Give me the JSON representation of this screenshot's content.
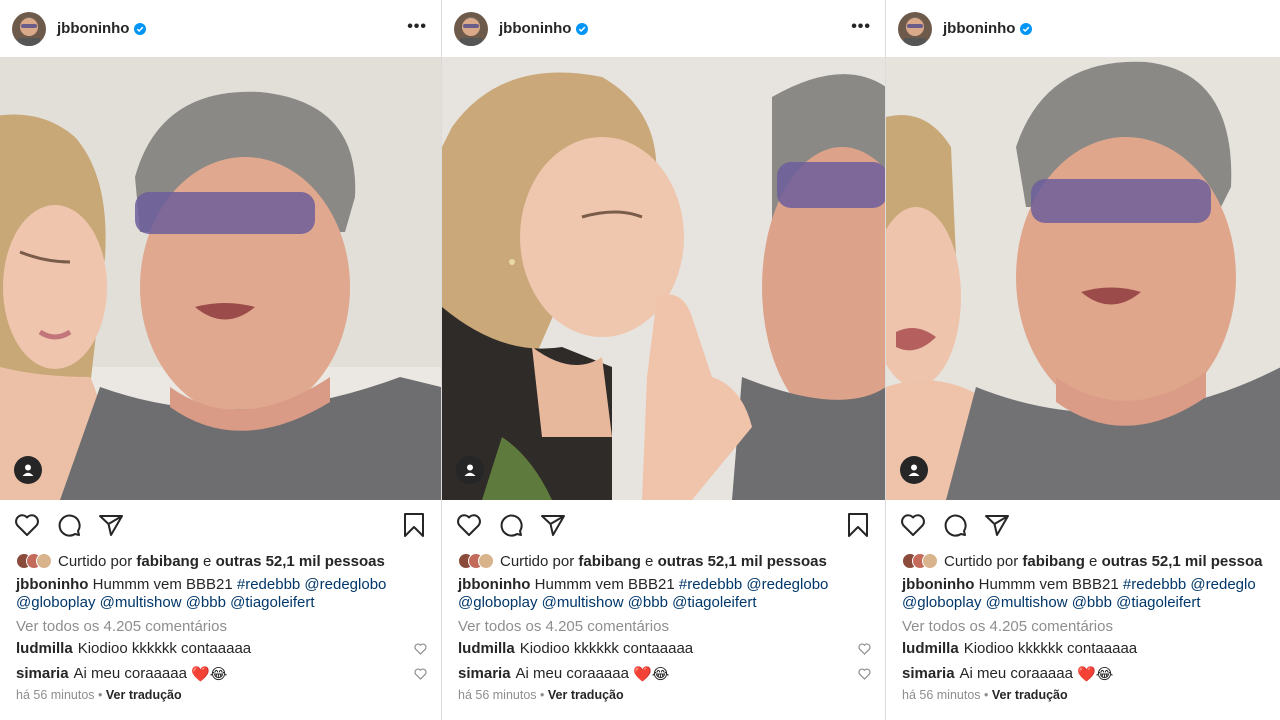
{
  "posts": [
    {
      "username": "jbboninho",
      "more_label": "•••",
      "likes": {
        "prefix": "Curtido por",
        "liker": "fabibang",
        "joiner": "e",
        "rest": "outras 52,1 mil pessoas"
      },
      "caption": {
        "username": "jbboninho",
        "text": "Hummm vem BBB21",
        "tags_line1": "#redebbb @redeglobo",
        "tags_line2": "@globoplay @multishow @bbb @tiagoleifert"
      },
      "view_all": "Ver todos os 4.205 comentários",
      "comments": [
        {
          "username": "ludmilla",
          "text": "Kiodioo kkkkkk contaaaaa",
          "emoji": ""
        },
        {
          "username": "simaria",
          "text": "Ai meu coraaaaa",
          "emoji": "❤️😂"
        }
      ],
      "time": "há 56 minutos",
      "separator": "•",
      "translate": "Ver tradução"
    },
    {
      "username": "jbboninho",
      "more_label": "•••",
      "likes": {
        "prefix": "Curtido por",
        "liker": "fabibang",
        "joiner": "e",
        "rest": "outras 52,1 mil pessoas"
      },
      "caption": {
        "username": "jbboninho",
        "text": "Hummm vem BBB21",
        "tags_line1": "#redebbb @redeglobo",
        "tags_line2": "@globoplay @multishow @bbb @tiagoleifert"
      },
      "view_all": "Ver todos os 4.205 comentários",
      "comments": [
        {
          "username": "ludmilla",
          "text": "Kiodioo kkkkkk contaaaaa",
          "emoji": ""
        },
        {
          "username": "simaria",
          "text": "Ai meu coraaaaa",
          "emoji": "❤️😂"
        }
      ],
      "time": "há 56 minutos",
      "separator": "•",
      "translate": "Ver tradução"
    },
    {
      "username": "jbboninho",
      "more_label": "",
      "likes": {
        "prefix": "Curtido por",
        "liker": "fabibang",
        "joiner": "e",
        "rest": "outras 52,1 mil pessoa"
      },
      "caption": {
        "username": "jbboninho",
        "text": "Hummm vem BBB21",
        "tags_line1": "#redebbb @redeglo",
        "tags_line2": "@globoplay @multishow @bbb @tiagoleifert"
      },
      "view_all": "Ver todos os 4.205 comentários",
      "comments": [
        {
          "username": "ludmilla",
          "text": "Kiodioo kkkkkk contaaaaa",
          "emoji": ""
        },
        {
          "username": "simaria",
          "text": "Ai meu coraaaaa",
          "emoji": "❤️😂"
        }
      ],
      "time": "há 56 minutos",
      "separator": "•",
      "translate": "Ver tradução"
    }
  ],
  "colors": {
    "verified": "#0095f6",
    "text": "#262626",
    "muted": "#8e8e8e",
    "link": "#00376b"
  }
}
